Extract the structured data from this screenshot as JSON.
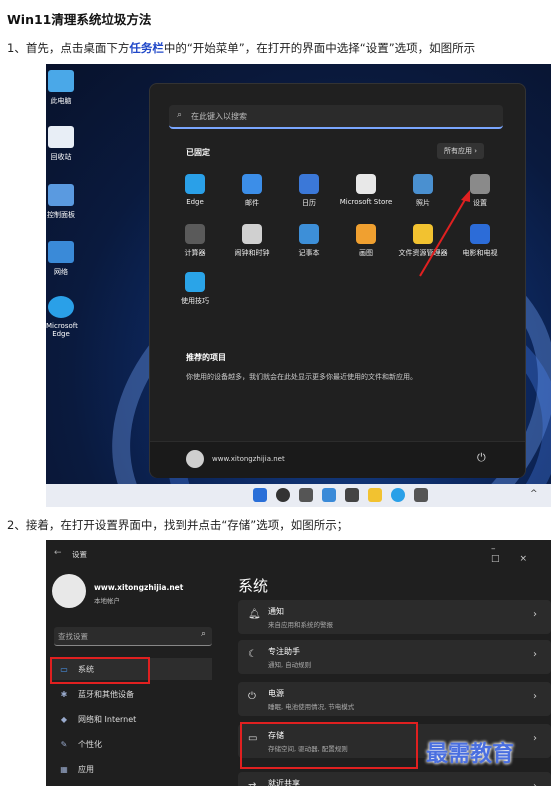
{
  "article": {
    "title": "Win11清理系统垃圾方法",
    "step1_a": "1、首先，点击桌面下方",
    "step1_link": "任务栏",
    "step1_b": "中的“开始菜单”，在打开的界面中选择“设置”选项，如图所示",
    "step2": "2、接着，在打开设置界面中，找到并点击“存储”选项，如图所示；"
  },
  "desktop": {
    "icons": [
      "此电脑",
      "回收站",
      "控制面板",
      "网络",
      "Microsoft Edge"
    ]
  },
  "start_menu": {
    "search_placeholder": "在此键入以搜索",
    "pinned_label": "已固定",
    "all_apps": "所有应用",
    "apps": [
      {
        "label": "Edge",
        "color": "#2aa0e8"
      },
      {
        "label": "邮件",
        "color": "#3c8ee8"
      },
      {
        "label": "日历",
        "color": "#3b78d8"
      },
      {
        "label": "Microsoft Store",
        "color": "#e8e8e8"
      },
      {
        "label": "照片",
        "color": "#4a90d0"
      },
      {
        "label": "设置",
        "color": "#8a8a8a"
      },
      {
        "label": "计算器",
        "color": "#5a5a5a"
      },
      {
        "label": "闹钟和时钟",
        "color": "#d0d0d0"
      },
      {
        "label": "记事本",
        "color": "#3d8fd8"
      },
      {
        "label": "画图",
        "color": "#f0a030"
      },
      {
        "label": "文件资源管理器",
        "color": "#f2c230"
      },
      {
        "label": "电影和电视",
        "color": "#2c6cd8"
      },
      {
        "label": "使用技巧",
        "color": "#2aa4e8"
      }
    ],
    "recommended_title": "推荐的项目",
    "recommended_text": "你使用的设备越多，我们就会在此处显示更多你最近使用的文件和新应用。",
    "user": "www.xitongzhijia.net"
  },
  "settings": {
    "window_title": "设置",
    "account_name": "www.xitongzhijia.net",
    "account_type": "本地帐户",
    "search_placeholder": "查找设置",
    "heading": "系统",
    "nav": [
      "系统",
      "蓝牙和其他设备",
      "网络和 Internet",
      "个性化",
      "应用"
    ],
    "cards": [
      {
        "title": "通知",
        "sub": "来自应用和系统的警报"
      },
      {
        "title": "专注助手",
        "sub": "通知, 自动规则"
      },
      {
        "title": "电源",
        "sub": "睡眠, 电池使用情况, 节电模式"
      },
      {
        "title": "存储",
        "sub": "存储空间, 驱动器, 配置规则"
      },
      {
        "title": "就近共享",
        "sub": ""
      }
    ]
  },
  "watermark": "最需教育",
  "colors": {
    "accent_red": "#e02020",
    "link_blue": "#2048c8"
  }
}
